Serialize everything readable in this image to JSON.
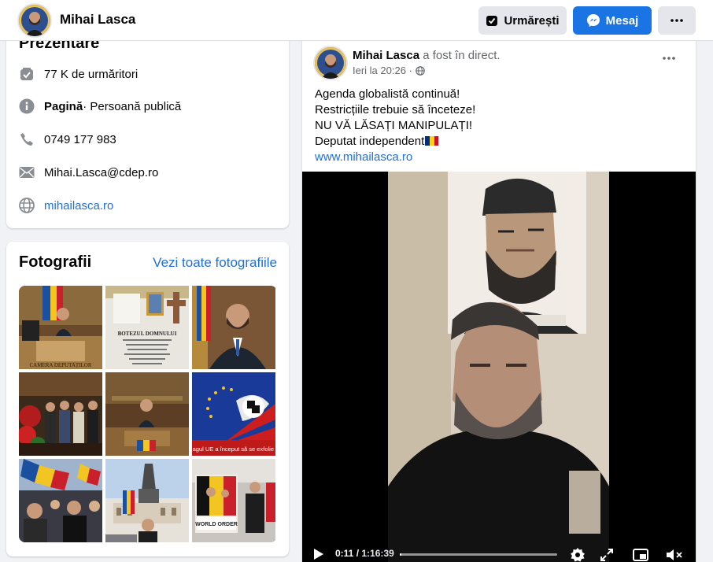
{
  "header": {
    "name": "Mihai Lasca",
    "follow_label": "Urmărești",
    "message_label": "Mesaj"
  },
  "intro": {
    "title": "Prezentare",
    "followers": "77 K de urmăritori",
    "page_type_bold": "Pagină",
    "page_type_rest": " · Persoană publică",
    "phone": "0749 177 983",
    "email": "Mihai.Lasca@cdep.ro",
    "website": "mihailasca.ro"
  },
  "photos": {
    "title": "Fotografii",
    "see_all": "Vezi toate fotografiile",
    "captions": {
      "p1": "CAMERA DEPUTAȚILOR",
      "p2_title": "BOTEZUL DOMNULUI",
      "p6": "agul UE a început să se exfolie",
      "p9": "WORLD ORDER"
    }
  },
  "post": {
    "author": "Mihai Lasca",
    "action": " a fost în direct.",
    "time": "Ieri la 20:26 ·",
    "lines": [
      "Agenda globalistă continuă!",
      "Restricțiile trebuie să înceteze!",
      "NU VĂ LĂSAȚI MANIPULAȚI!",
      "Deputat independent"
    ],
    "url": "www.mihailasca.ro",
    "flag_colors": [
      "#002b7f",
      "#fcd116",
      "#ce1126"
    ]
  },
  "video": {
    "current": "0:11",
    "separator": " / ",
    "duration": "1:16:39",
    "progress": 0.002
  },
  "colors": {
    "accent": "#1b74e4",
    "link": "#216fdb"
  },
  "icons": [
    "check-box-icon",
    "info-icon",
    "phone-icon",
    "mail-icon",
    "globe-icon",
    "messenger-icon",
    "more-icon",
    "globe-small-icon",
    "play-icon",
    "settings-icon",
    "fullscreen-icon",
    "miniplayer-icon",
    "mute-icon"
  ]
}
